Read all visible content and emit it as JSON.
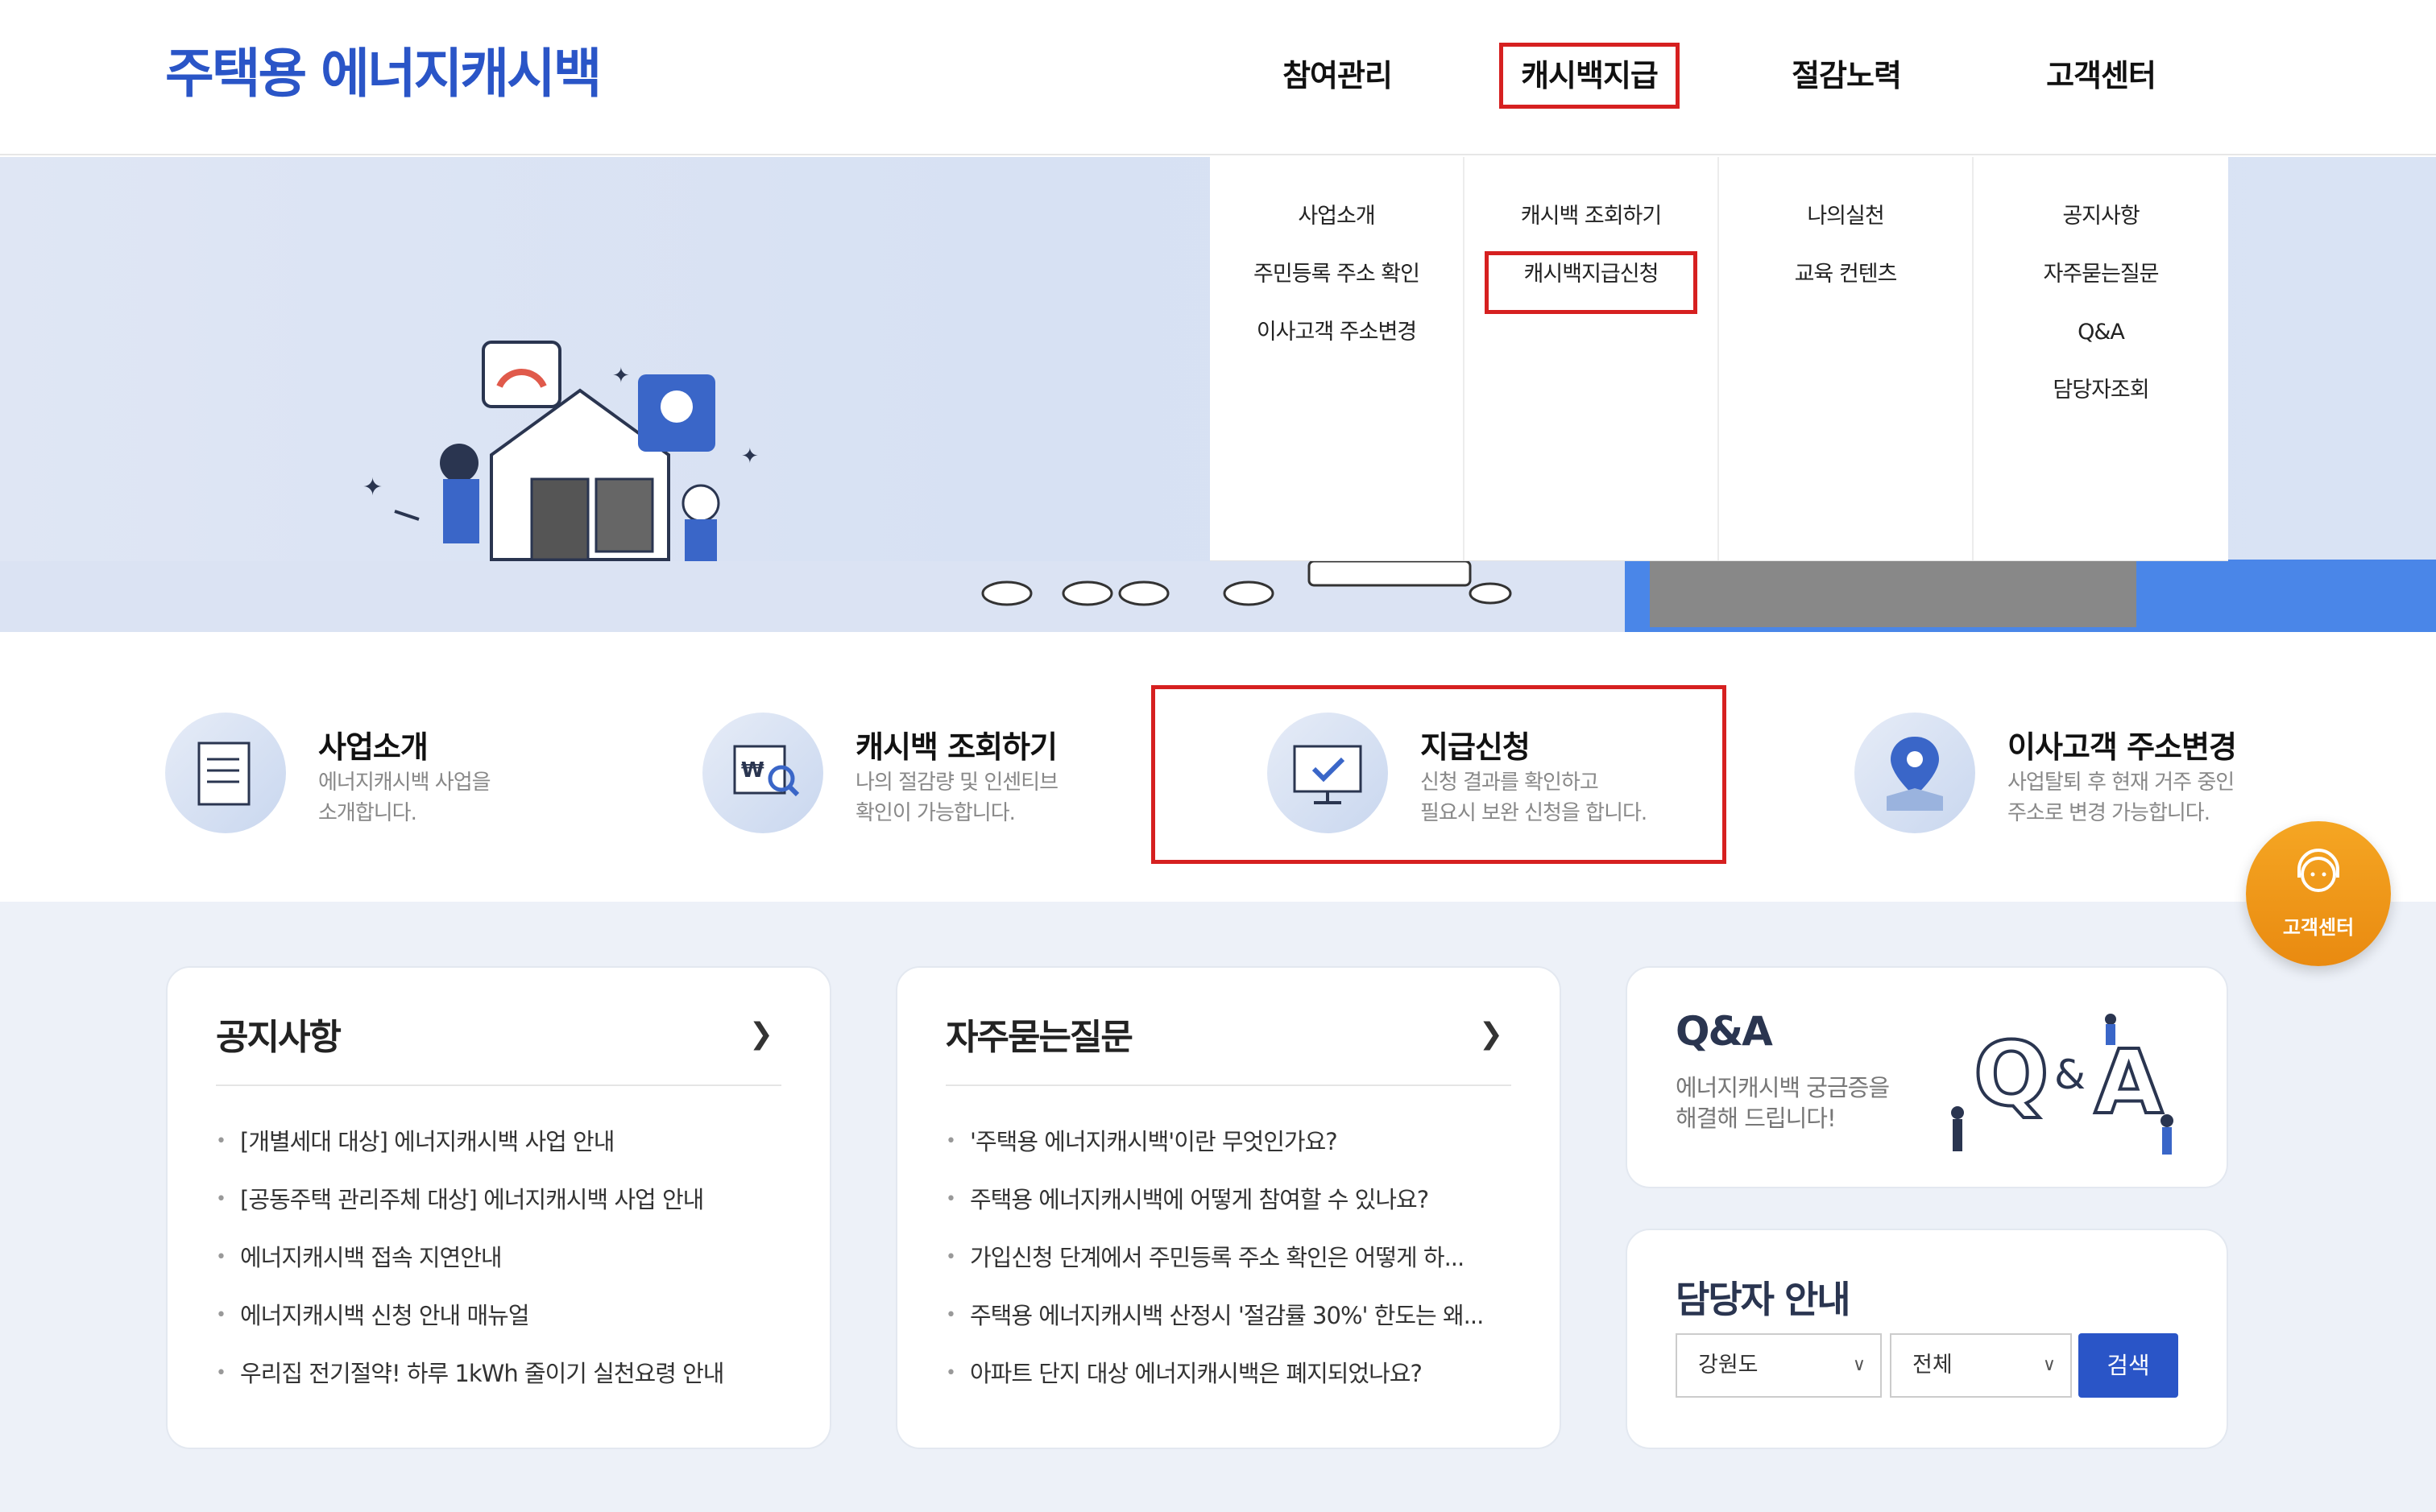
{
  "header": {
    "logo": "주택용 에너지캐시백",
    "nav": [
      "참여관리",
      "캐시백지급",
      "절감노력",
      "고객센터"
    ]
  },
  "mega_menu": {
    "columns": [
      [
        "사업소개",
        "주민등록 주소 확인",
        "이사고객 주소변경"
      ],
      [
        "캐시백 조회하기",
        "캐시백지급신청"
      ],
      [
        "나의실천",
        "교육 컨텐츠"
      ],
      [
        "공지사항",
        "자주묻는질문",
        "Q&A",
        "담당자조회"
      ]
    ]
  },
  "quick_links": [
    {
      "title": "사업소개",
      "desc": "에너지캐시백 사업을\n소개합니다.",
      "icon": "document-icon"
    },
    {
      "title": "캐시백 조회하기",
      "desc": "나의 절감량 및 인센티브\n확인이 가능합니다.",
      "icon": "won-search-icon"
    },
    {
      "title": "지급신청",
      "desc": "신청 결과를 확인하고\n필요시 보완 신청을 합니다.",
      "icon": "monitor-check-icon"
    },
    {
      "title": "이사고객 주소변경",
      "desc": "사업탈퇴 후 현재 거주 중인\n주소로 변경 가능합니다.",
      "icon": "location-pin-icon"
    }
  ],
  "notice": {
    "title": "공지사항",
    "items": [
      "[개별세대 대상] 에너지캐시백 사업 안내",
      "[공동주택 관리주체 대상] 에너지캐시백 사업 안내",
      "에너지캐시백 접속 지연안내",
      "에너지캐시백 신청 안내 매뉴얼",
      "우리집 전기절약! 하루 1kWh 줄이기 실천요령 안내"
    ]
  },
  "faq": {
    "title": "자주묻는질문",
    "items": [
      "'주택용 에너지캐시백'이란 무엇인가요?",
      "주택용 에너지캐시백에 어떻게 참여할 수 있나요?",
      "가입신청 단계에서 주민등록 주소 확인은 어떻게 하...",
      "주택용 에너지캐시백 산정시 '절감률 30%' 한도는 왜...",
      "아파트 단지 대상 에너지캐시백은 폐지되었나요?"
    ]
  },
  "qa": {
    "title": "Q&A",
    "desc": "에너지캐시백 궁금증을\n해결해 드립니다!"
  },
  "manager": {
    "title": "담당자 안내",
    "region": "강원도",
    "scope": "전체",
    "search_label": "검색"
  },
  "floating": {
    "label": "고객센터"
  },
  "colors": {
    "brand": "#2a55c7",
    "highlight": "#d62020",
    "floating": "#f0961a"
  }
}
